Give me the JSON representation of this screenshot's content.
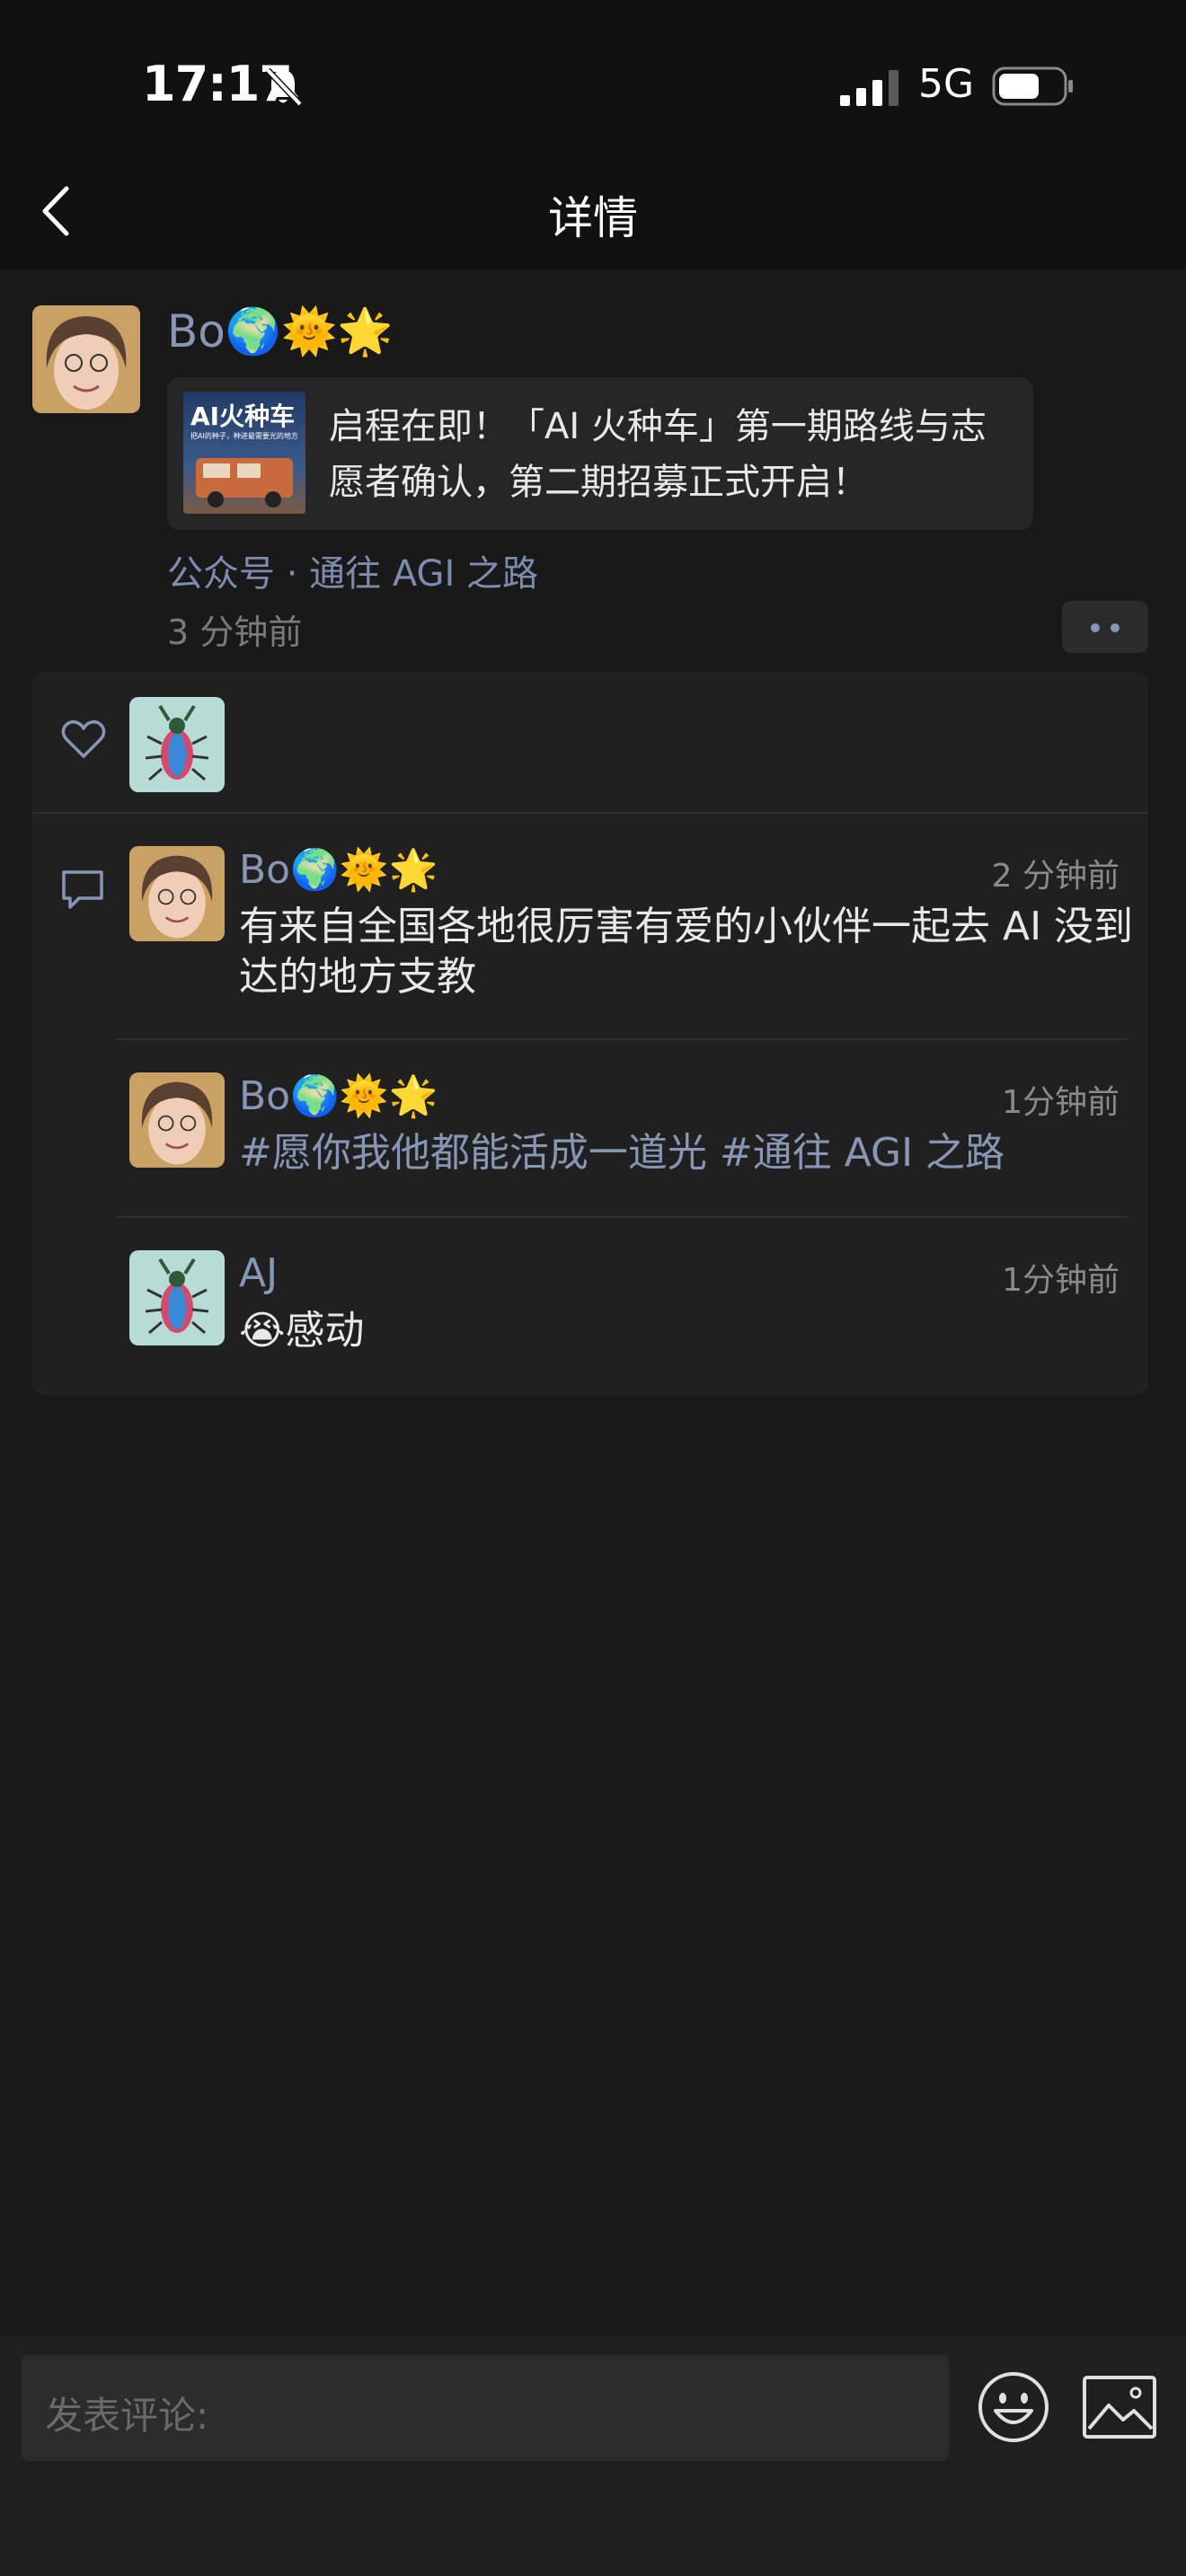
{
  "status_bar": {
    "time": "17:17",
    "network": "5G"
  },
  "nav": {
    "title": "详情"
  },
  "post": {
    "author": "Bo🌍🌞🌟",
    "link_card": {
      "thumb_title": "AI火种车",
      "thumb_subtitle": "把AI的种子，种进最需要光的地方",
      "text": "启程在即！「AI 火种车」第一期路线与志愿者确认，第二期招募正式开启！"
    },
    "source": "公众号 · 通往 AGI 之路",
    "time": "3 分钟前"
  },
  "comments": [
    {
      "author": "Bo🌍🌞🌟",
      "time": "2 分钟前",
      "text": "有来自全国各地很厉害有爱的小伙伴一起去 AI 没到达的地方支教"
    },
    {
      "author": "Bo🌍🌞🌟",
      "time": "1分钟前",
      "text": "#愿你我他都能活成一道光 #通往 AGI 之路"
    },
    {
      "author": "AJ",
      "time": "1分钟前",
      "text": "😭感动"
    }
  ],
  "composer": {
    "placeholder": "发表评论:"
  },
  "colors": {
    "background": "#191919",
    "link": "#8796b5",
    "panel": "#202020"
  }
}
